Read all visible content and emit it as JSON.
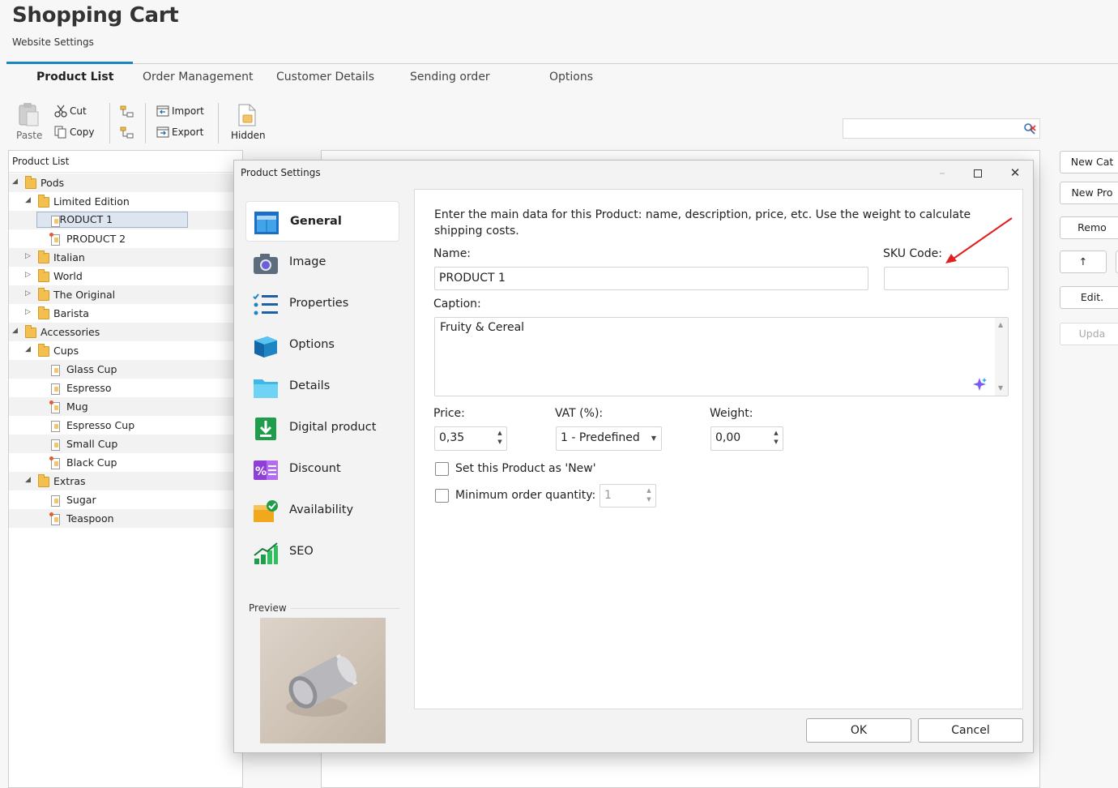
{
  "app": {
    "title": "Shopping Cart",
    "subtitle": "Website Settings"
  },
  "tabs": [
    {
      "label": "Product List",
      "active": true
    },
    {
      "label": "Order Management"
    },
    {
      "label": "Customer Details"
    },
    {
      "label": "Sending order"
    },
    {
      "label": "Options"
    }
  ],
  "toolbar": {
    "paste": "Paste",
    "cut": "Cut",
    "copy": "Copy",
    "import": "Import",
    "export": "Export",
    "hidden": "Hidden"
  },
  "left_panel": {
    "header": "Product List"
  },
  "tree": [
    {
      "label": "Pods",
      "level": 0,
      "type": "folder",
      "expanded": true
    },
    {
      "label": "Limited Edition",
      "level": 1,
      "type": "folder",
      "expanded": true
    },
    {
      "label": "PRODUCT 1",
      "level": 2,
      "type": "file",
      "selected": true
    },
    {
      "label": "PRODUCT 2",
      "level": 2,
      "type": "file"
    },
    {
      "label": "Italian",
      "level": 1,
      "type": "folder",
      "expanded": false
    },
    {
      "label": "World",
      "level": 1,
      "type": "folder",
      "expanded": false
    },
    {
      "label": "The Original",
      "level": 1,
      "type": "folder",
      "expanded": false
    },
    {
      "label": "Barista",
      "level": 1,
      "type": "folder",
      "expanded": false
    },
    {
      "label": "Accessories",
      "level": 0,
      "type": "folder",
      "expanded": true
    },
    {
      "label": "Cups",
      "level": 1,
      "type": "folder",
      "expanded": true
    },
    {
      "label": "Glass Cup",
      "level": 2,
      "type": "file"
    },
    {
      "label": "Espresso",
      "level": 2,
      "type": "file"
    },
    {
      "label": "Mug",
      "level": 2,
      "type": "file"
    },
    {
      "label": "Espresso Cup",
      "level": 2,
      "type": "file"
    },
    {
      "label": "Small Cup",
      "level": 2,
      "type": "file"
    },
    {
      "label": "Black Cup",
      "level": 2,
      "type": "file"
    },
    {
      "label": "Extras",
      "level": 1,
      "type": "folder",
      "expanded": true
    },
    {
      "label": "Sugar",
      "level": 2,
      "type": "file"
    },
    {
      "label": "Teaspoon",
      "level": 2,
      "type": "file"
    }
  ],
  "right_buttons": {
    "new_cat": "New Cat",
    "new_pro": "New Pro",
    "remo": "Remo",
    "up_arrow": "↑",
    "edit": "Edit.",
    "upda": "Upda"
  },
  "dialog": {
    "title": "Product Settings",
    "nav": [
      {
        "label": "General",
        "icon": "general-icon",
        "selected": true
      },
      {
        "label": "Image",
        "icon": "camera-icon"
      },
      {
        "label": "Properties",
        "icon": "list-icon"
      },
      {
        "label": "Options",
        "icon": "cube-icon"
      },
      {
        "label": "Details",
        "icon": "folder-icon"
      },
      {
        "label": "Digital product",
        "icon": "download-icon"
      },
      {
        "label": "Discount",
        "icon": "percent-icon"
      },
      {
        "label": "Availability",
        "icon": "box-check-icon"
      },
      {
        "label": "SEO",
        "icon": "growth-chart-icon"
      }
    ],
    "preview_label": "Preview",
    "intro": "Enter the main data for this Product: name, description, price, etc. Use the weight to calculate shipping costs.",
    "name_label": "Name:",
    "name_value": "PRODUCT 1",
    "sku_label": "SKU Code:",
    "sku_value": "",
    "caption_label": "Caption:",
    "caption_value": "Fruity & Cereal",
    "price_label": "Price:",
    "price_value": "0,35",
    "vat_label": "VAT (%):",
    "vat_value": "1 - Predefined",
    "weight_label": "Weight:",
    "weight_value": "0,00",
    "new_label": "Set this Product as 'New'",
    "new_checked": false,
    "min_qty_label": "Minimum order quantity:",
    "min_qty_checked": false,
    "min_qty_value": "1",
    "ok": "OK",
    "cancel": "Cancel"
  },
  "colors": {
    "accent": "#1e84c2",
    "annotation_arrow": "#e02020"
  }
}
